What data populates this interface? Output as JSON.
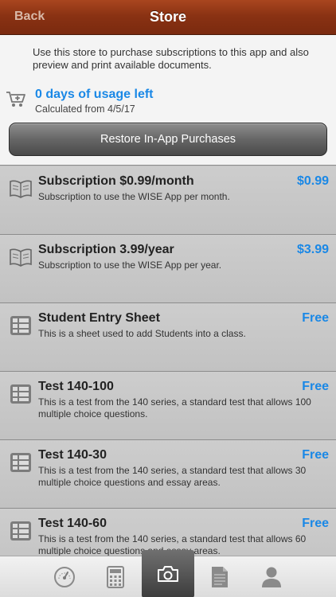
{
  "navbar": {
    "back_label": "Back",
    "title": "Store"
  },
  "intro": {
    "description": "Use this store to purchase subscriptions to this app and also preview and print available documents.",
    "days_left": "0 days of usage left",
    "calculated": "Calculated from 4/5/17",
    "restore_label": "Restore In-App Purchases",
    "icon": "cart-add-icon"
  },
  "items": [
    {
      "name": "Subscription $0.99/month",
      "price": "$0.99",
      "desc": "Subscription to use the WISE App per month.",
      "icon": "book-icon"
    },
    {
      "name": "Subscription 3.99/year",
      "price": "$3.99",
      "desc": "Subscription to use the WISE App per year.",
      "icon": "book-icon"
    },
    {
      "name": "Student Entry Sheet",
      "price": "Free",
      "desc": "This is a sheet used to add Students into a class.",
      "icon": "form-icon"
    },
    {
      "name": "Test 140-100",
      "price": "Free",
      "desc": "This is a test from the 140 series, a standard test that allows 100 multiple choice questions.",
      "icon": "form-icon"
    },
    {
      "name": "Test 140-30",
      "price": "Free",
      "desc": "This is a test from the 140 series, a standard test that allows 30 multiple choice questions and essay areas.",
      "icon": "form-icon"
    },
    {
      "name": "Test 140-60",
      "price": "Free",
      "desc": "This is a test from the 140 series, a standard test that allows 60 multiple choice questions and essay areas.",
      "icon": "form-icon"
    }
  ],
  "tabs": [
    {
      "icon": "gauge-icon"
    },
    {
      "icon": "calculator-icon"
    },
    {
      "icon": "camera-icon",
      "active": true
    },
    {
      "icon": "document-icon"
    },
    {
      "icon": "person-icon"
    }
  ],
  "colors": {
    "accent": "#1a88e6",
    "nav": "#8a3213"
  }
}
